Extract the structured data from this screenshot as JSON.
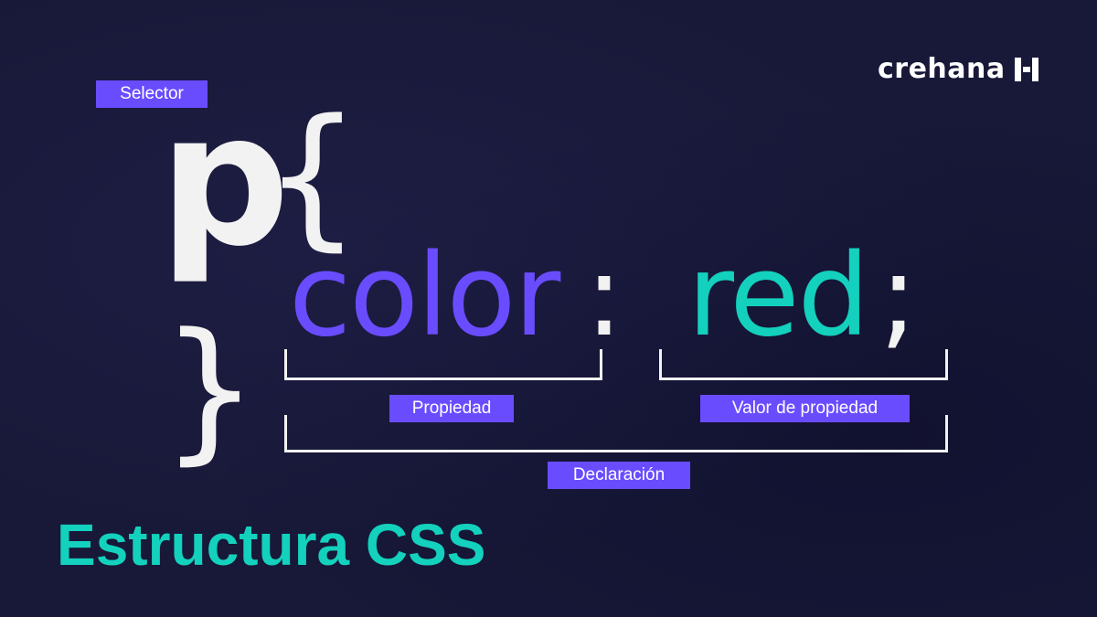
{
  "brand": {
    "name": "crehana",
    "icon": "crehana-logo-icon"
  },
  "code": {
    "selector": "p",
    "open_brace": "{",
    "close_brace": "}",
    "property": "color",
    "colon": ":",
    "value": "red",
    "semicolon": ";"
  },
  "labels": {
    "selector": "Selector",
    "property": "Propiedad",
    "value": "Valor de propiedad",
    "declaration": "Declaración"
  },
  "title": "Estructura CSS",
  "colors": {
    "background": "#181838",
    "accent_purple": "#6a4cff",
    "accent_teal": "#13d1bd",
    "foreground": "#f2f2f2"
  }
}
